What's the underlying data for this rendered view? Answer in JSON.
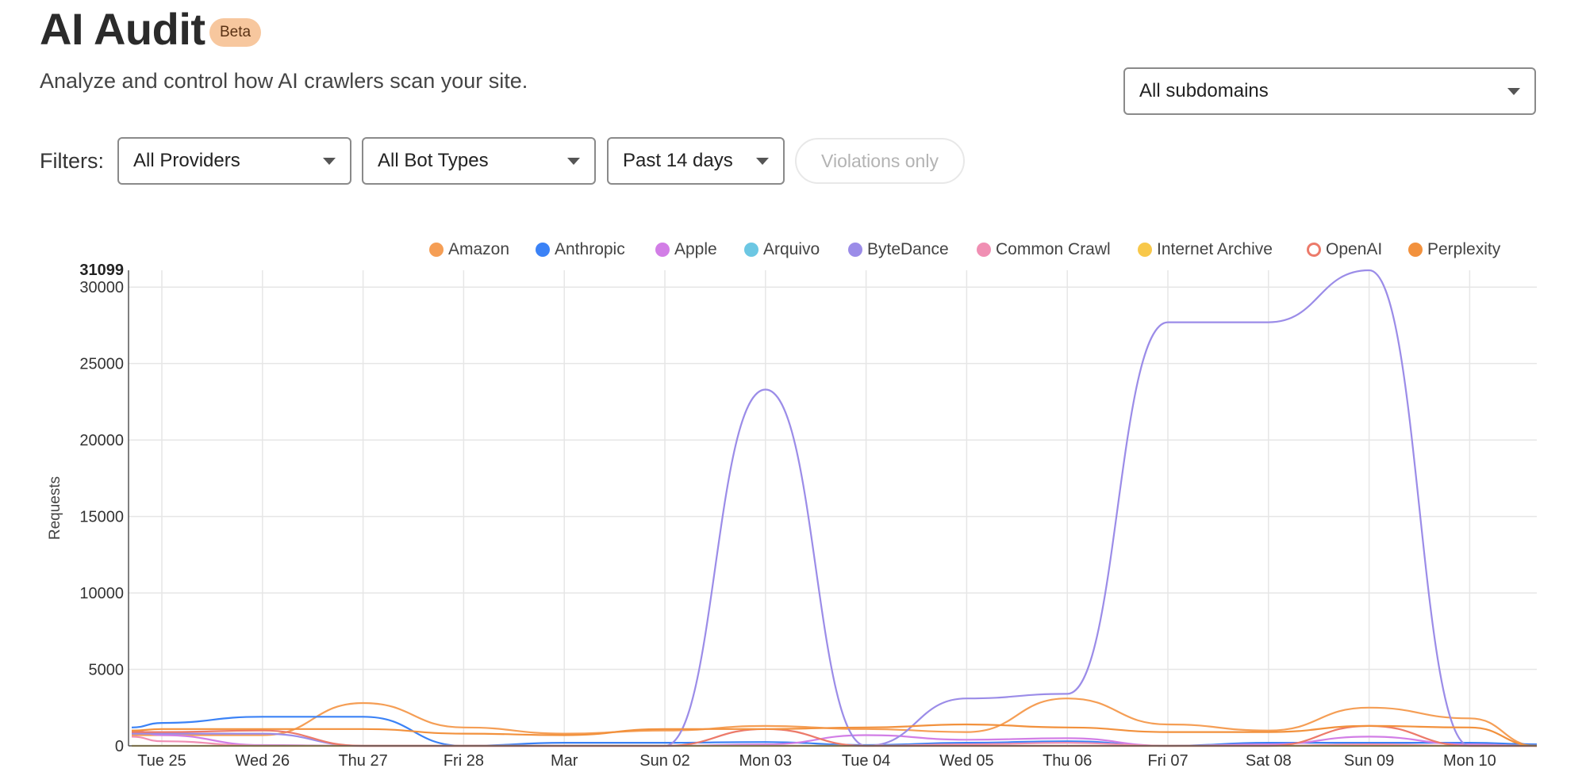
{
  "header": {
    "title": "AI Audit",
    "badge": "Beta",
    "subtitle": "Analyze and control how AI crawlers scan your site."
  },
  "subdomain_select": {
    "value": "All subdomains"
  },
  "filters": {
    "label": "Filters:",
    "providers": "All Providers",
    "bot_types": "All Bot Types",
    "range": "Past 14 days",
    "violations_toggle": "Violations only"
  },
  "legend": [
    {
      "name": "Amazon",
      "color": "#f59e55",
      "hollow": false
    },
    {
      "name": "Anthropic",
      "color": "#3b82f6",
      "hollow": false
    },
    {
      "name": "Apple",
      "color": "#d27ee6",
      "hollow": false
    },
    {
      "name": "Arquivo",
      "color": "#6cc7e3",
      "hollow": false
    },
    {
      "name": "ByteDance",
      "color": "#9b8ce8",
      "hollow": false
    },
    {
      "name": "Common Crawl",
      "color": "#f08fb3",
      "hollow": false
    },
    {
      "name": "Internet Archive",
      "color": "#f8c84a",
      "hollow": false
    },
    {
      "name": "OpenAI",
      "color": "#ec7a6a",
      "hollow": true
    },
    {
      "name": "Perplexity",
      "color": "#f2913d",
      "hollow": false
    }
  ],
  "chart_data": {
    "type": "line",
    "ylabel": "Requests",
    "ylim": [
      0,
      31099
    ],
    "ymax_label": "31099",
    "yticks": [
      0,
      5000,
      10000,
      15000,
      20000,
      25000,
      30000
    ],
    "grid": true,
    "legend_position": "top",
    "categories": [
      "Tue 25",
      "Wed 26",
      "Thu 27",
      "Fri 28",
      "Mar",
      "Sun 02",
      "Mon 03",
      "Tue 04",
      "Wed 05",
      "Thu 06",
      "Fri 07",
      "Sat 08",
      "Sun 09",
      "Mon 10"
    ],
    "x": [
      -0.3,
      0,
      1,
      2,
      3,
      4,
      5,
      6,
      7,
      8,
      9,
      10,
      11,
      12,
      13,
      13.7
    ],
    "series": [
      {
        "name": "Amazon",
        "color": "#f59e55",
        "values": [
          700,
          700,
          700,
          2800,
          1200,
          800,
          1000,
          1300,
          1100,
          900,
          3100,
          1400,
          1000,
          2500,
          1800,
          0
        ]
      },
      {
        "name": "Anthropic",
        "color": "#3b82f6",
        "values": [
          1200,
          1500,
          1900,
          1900,
          0,
          200,
          200,
          250,
          50,
          200,
          300,
          0,
          200,
          200,
          200,
          100
        ]
      },
      {
        "name": "Apple",
        "color": "#d27ee6",
        "values": [
          1000,
          700,
          50,
          0,
          0,
          0,
          0,
          100,
          700,
          400,
          500,
          0,
          100,
          600,
          100,
          0
        ]
      },
      {
        "name": "Arquivo",
        "color": "#6cc7e3",
        "values": [
          0,
          0,
          0,
          0,
          0,
          0,
          0,
          0,
          0,
          0,
          0,
          0,
          0,
          0,
          0,
          0
        ]
      },
      {
        "name": "ByteDance",
        "color": "#9b8ce8",
        "values": [
          800,
          800,
          800,
          0,
          0,
          0,
          0,
          23300,
          0,
          3100,
          3400,
          27700,
          27700,
          31099,
          0,
          0
        ]
      },
      {
        "name": "Common Crawl",
        "color": "#f08fb3",
        "values": [
          600,
          300,
          0,
          0,
          0,
          0,
          0,
          0,
          0,
          100,
          200,
          0,
          0,
          100,
          0,
          0
        ]
      },
      {
        "name": "Internet Archive",
        "color": "#f8c84a",
        "values": [
          0,
          0,
          0,
          0,
          0,
          0,
          0,
          0,
          0,
          0,
          0,
          0,
          0,
          0,
          0,
          0
        ]
      },
      {
        "name": "OpenAI",
        "color": "#ec7a6a",
        "values": [
          900,
          900,
          1000,
          0,
          0,
          0,
          0,
          1100,
          0,
          0,
          0,
          0,
          0,
          1300,
          0,
          0
        ]
      },
      {
        "name": "Perplexity",
        "color": "#f2913d",
        "values": [
          1000,
          1100,
          1100,
          1100,
          800,
          700,
          1100,
          1100,
          1200,
          1400,
          1200,
          900,
          900,
          1300,
          1200,
          0
        ]
      }
    ]
  }
}
